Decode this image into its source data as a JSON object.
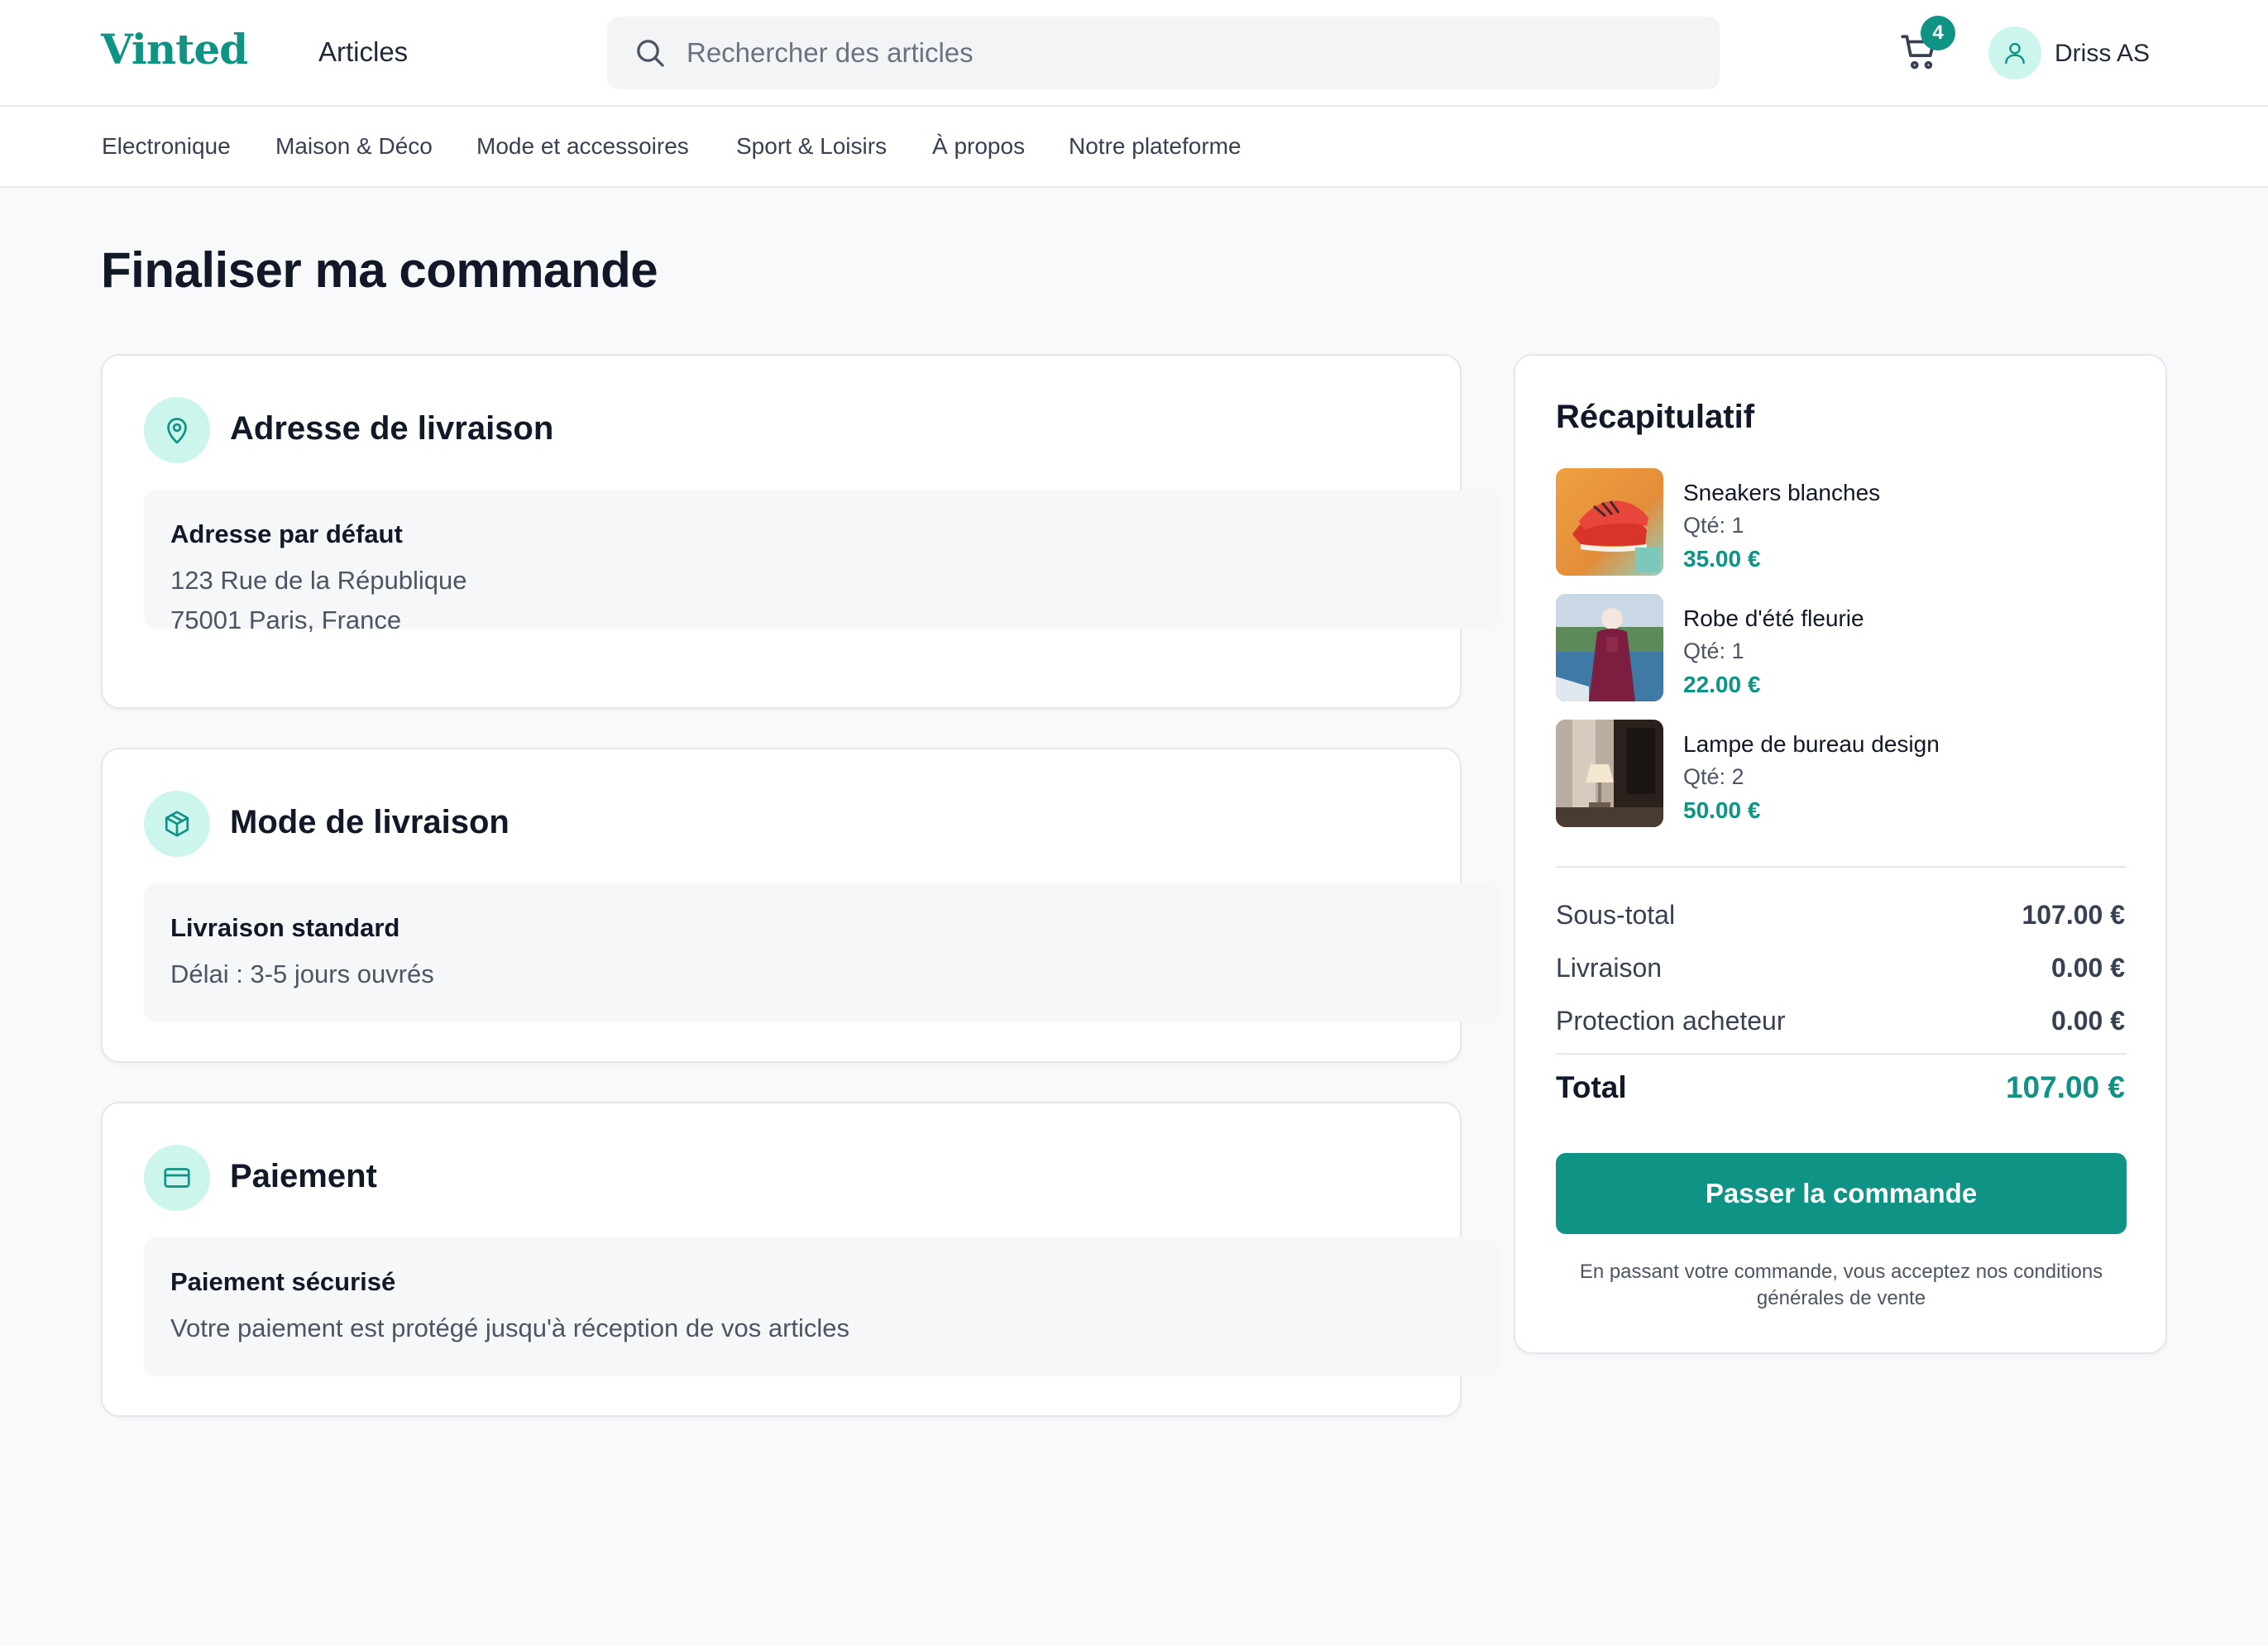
{
  "brand": {
    "logo": "Vinted",
    "accent": "#0f9384",
    "accent_light": "#ccf5ee"
  },
  "header": {
    "nav_articles": "Articles",
    "search": {
      "placeholder": "Rechercher des articles",
      "value": ""
    },
    "cart": {
      "icon": "cart-icon",
      "count": "4"
    },
    "user": {
      "icon": "user-icon",
      "name": "Driss AS"
    }
  },
  "categories": [
    "Electronique",
    "Maison & Déco",
    "Mode et accessoires",
    "Sport & Loisirs",
    "À propos",
    "Notre plateforme"
  ],
  "page": {
    "title": "Finaliser ma commande"
  },
  "address": {
    "icon": "map-pin-icon",
    "title": "Adresse de livraison",
    "box_title": "Adresse par défaut",
    "line1": "123 Rue de la République",
    "line2": "75001 Paris, France"
  },
  "shipping": {
    "icon": "package-icon",
    "title": "Mode de livraison",
    "box_title": "Livraison standard",
    "line1": "Délai : 3-5 jours ouvrés"
  },
  "payment": {
    "icon": "credit-card-icon",
    "title": "Paiement",
    "box_title": "Paiement sécurisé",
    "line1": "Votre paiement est protégé jusqu'à réception de vos articles"
  },
  "summary": {
    "title": "Récapitulatif",
    "items": [
      {
        "name": "Sneakers blanches",
        "qty": "Qté: 1",
        "price": "35.00 €"
      },
      {
        "name": "Robe d'été fleurie",
        "qty": "Qté: 1",
        "price": "22.00 €"
      },
      {
        "name": "Lampe de bureau design",
        "qty": "Qté: 2",
        "price": "50.00 €"
      }
    ],
    "subtotal_label": "Sous-total",
    "subtotal_value": "107.00 €",
    "shipping_label": "Livraison",
    "shipping_value": "0.00 €",
    "protection_label": "Protection acheteur",
    "protection_value": "0.00 €",
    "total_label": "Total",
    "total_value": "107.00 €",
    "order_button": "Passer la commande",
    "terms": "En passant votre commande, vous acceptez nos conditions générales de vente"
  }
}
